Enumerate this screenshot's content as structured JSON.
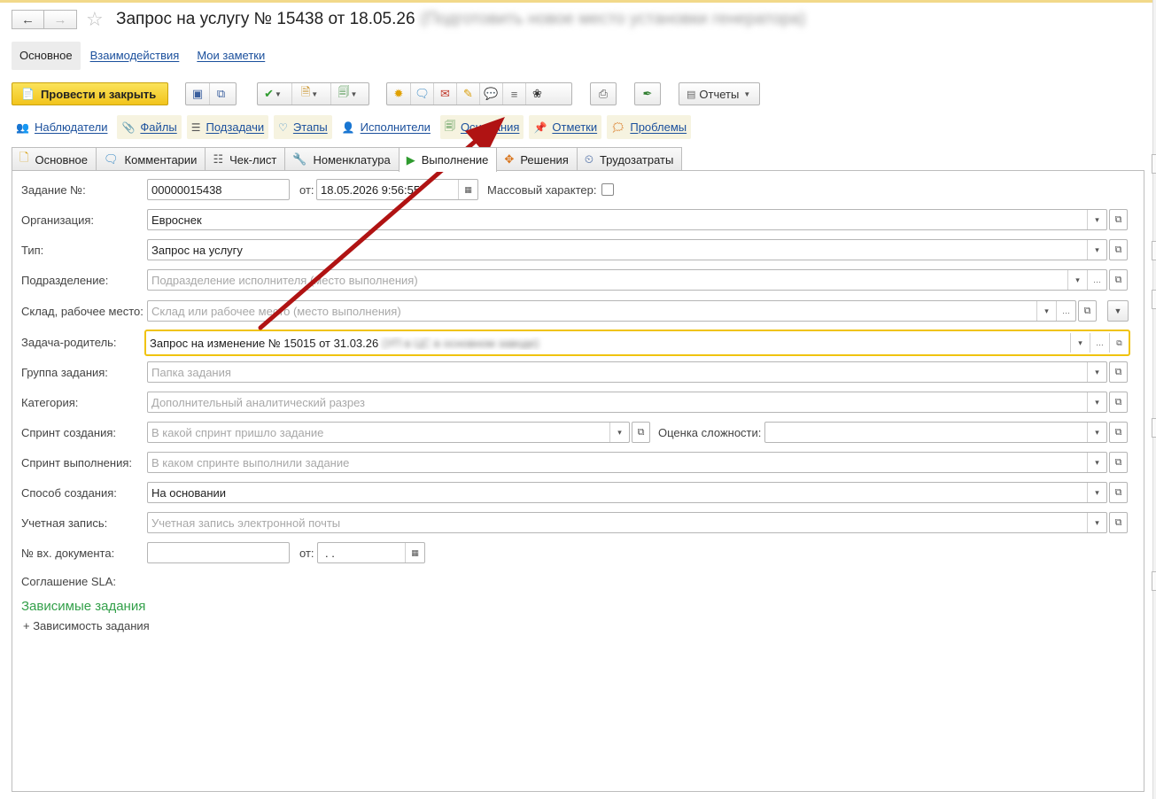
{
  "header": {
    "back_icon": "arrow-left-icon",
    "forward_icon": "arrow-right-icon",
    "title": "Запрос на услугу № 15438 от 18.05.26",
    "title_blurred": "(Подготовить новое место установки генератора)"
  },
  "section_tabs": [
    {
      "label": "Основное",
      "active": true
    },
    {
      "label": "Взаимодействия",
      "active": false
    },
    {
      "label": "Мои заметки",
      "active": false
    }
  ],
  "toolbar": {
    "primary_label": "Провести и закрыть",
    "reports_label": "Отчеты"
  },
  "sublinks": [
    {
      "label": "Наблюдатели",
      "icon": "people-icon"
    },
    {
      "label": "Файлы",
      "icon": "paperclip-icon"
    },
    {
      "label": "Подзадачи",
      "icon": "subtasks-icon"
    },
    {
      "label": "Этапы",
      "icon": "stages-icon"
    },
    {
      "label": "Исполнители",
      "icon": "executors-icon"
    },
    {
      "label": "Основания",
      "icon": "document-arrow-icon"
    },
    {
      "label": "Отметки",
      "icon": "pin-icon"
    },
    {
      "label": "Проблемы",
      "icon": "problems-icon"
    }
  ],
  "form_tabs": [
    {
      "label": "Основное",
      "icon": "document-icon"
    },
    {
      "label": "Комментарии",
      "icon": "comment-icon"
    },
    {
      "label": "Чек-лист",
      "icon": "checklist-icon"
    },
    {
      "label": "Номенклатура",
      "icon": "wrench-icon"
    },
    {
      "label": "Выполнение",
      "icon": "play-icon",
      "active": true
    },
    {
      "label": "Решения",
      "icon": "signpost-icon"
    },
    {
      "label": "Трудозатраты",
      "icon": "clock-icon"
    }
  ],
  "form": {
    "task_no_label": "Задание №:",
    "task_no_value": "00000015438",
    "date_from_label": "от:",
    "date_value": "18.05.2026  9:56:55",
    "mass_label": "Массовый характер:",
    "org_label": "Организация:",
    "org_value": "Евроснек",
    "type_label": "Тип:",
    "type_value": "Запрос на услугу",
    "dept_label": "Подразделение:",
    "dept_placeholder": "Подразделение исполнителя (место выполнения)",
    "warehouse_label": "Склад, рабочее место:",
    "warehouse_placeholder": "Склад или рабочее место (место выполнения)",
    "parent_label": "Задача-родитель:",
    "parent_value": "Запрос на изменение № 15015 от 31.03.26",
    "parent_blurred": "(УП в ЦС в основном заводе)",
    "group_label": "Группа задания:",
    "group_placeholder": "Папка задания",
    "category_label": "Категория:",
    "category_placeholder": "Дополнительный аналитический разрез",
    "sprint_create_label": "Спринт создания:",
    "sprint_create_placeholder": "В какой спринт пришло задание",
    "complexity_label": "Оценка сложности:",
    "sprint_exec_label": "Спринт выполнения:",
    "sprint_exec_placeholder": "В каком спринте выполнили задание",
    "method_label": "Способ создания:",
    "method_value": "На основании",
    "account_label": "Учетная запись:",
    "account_placeholder": "Учетная запись электронной почты",
    "incoming_label": "№ вх. документа:",
    "incoming_from_label": "от:",
    "incoming_date_value": " .  .",
    "sla_label": "Соглашение SLA:"
  },
  "dependent": {
    "title": "Зависимые задания",
    "add_label": "+ Зависимость задания"
  },
  "annotation": {
    "arrow_color": "#b01313"
  }
}
